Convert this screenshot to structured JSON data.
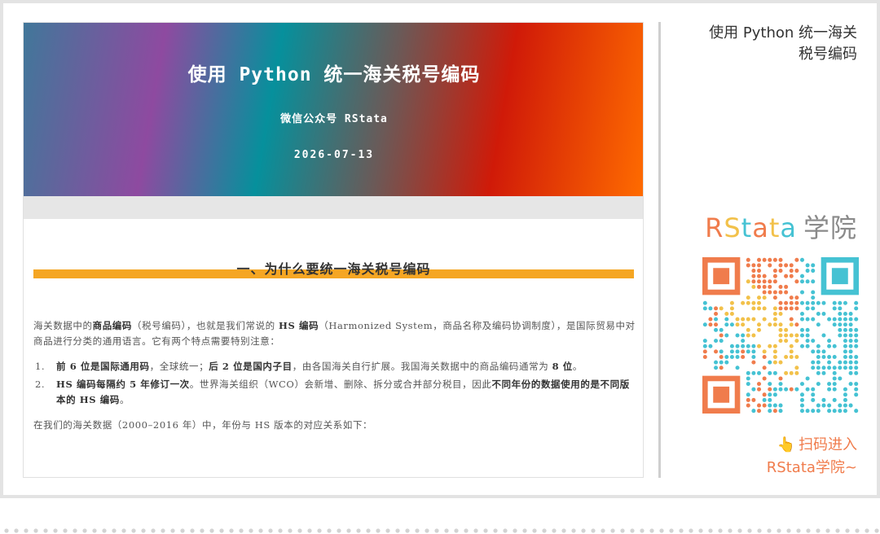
{
  "banner": {
    "title": "使用 Python 统一海关税号编码",
    "subtitle": "微信公众号 RStata",
    "date": "2026-07-13"
  },
  "section": {
    "title": "一、为什么要统一海关税号编码"
  },
  "intro": {
    "p1_a": "海关数据中的",
    "p1_b": "商品编码",
    "p1_c": "（税号编码），也就是我们常说的 ",
    "p1_d": "HS 编码",
    "p1_e": "（Harmonized System，商品名称及编码协调制度），是国际贸易中对商品进行分类的通用语言。它有两个特点需要特别注意："
  },
  "list": [
    {
      "num": "1.",
      "a": "前 6 位是国际通用码",
      "b": "，全球统一；",
      "c": "后 2 位是国内子目",
      "d": "，由各国海关自行扩展。我国海关数据中的商品编码通常为 ",
      "e": "8 位",
      "f": "。"
    },
    {
      "num": "2.",
      "a": "HS 编码每隔约 5 年修订一次",
      "b": "。世界海关组织（WCO）会新增、删除、拆分或合并部分税目，因此",
      "c": "不同年份的数据使用的是不同版本的 HS 编码",
      "d": "。"
    }
  ],
  "outro": "在我们的海关数据（2000–2016 年）中，年份与 HS 版本的对应关系如下：",
  "sidebar": {
    "title_line1": "使用 Python 统一海关",
    "title_line2": "税号编码",
    "brand": {
      "r": "R",
      "s": "S",
      "t1": "t",
      "a1": "a",
      "t2": "t",
      "a2": "a",
      "cn": "学院"
    },
    "scan_line1": "扫码进入",
    "scan_line2": "RStata学院~",
    "hand_icon": "pointing-hand-icon"
  },
  "colors": {
    "accent_bar": "#f5a623",
    "brand_orange": "#f07c4c",
    "brand_yellow": "#f2c14a",
    "brand_teal": "#45c2d3"
  }
}
